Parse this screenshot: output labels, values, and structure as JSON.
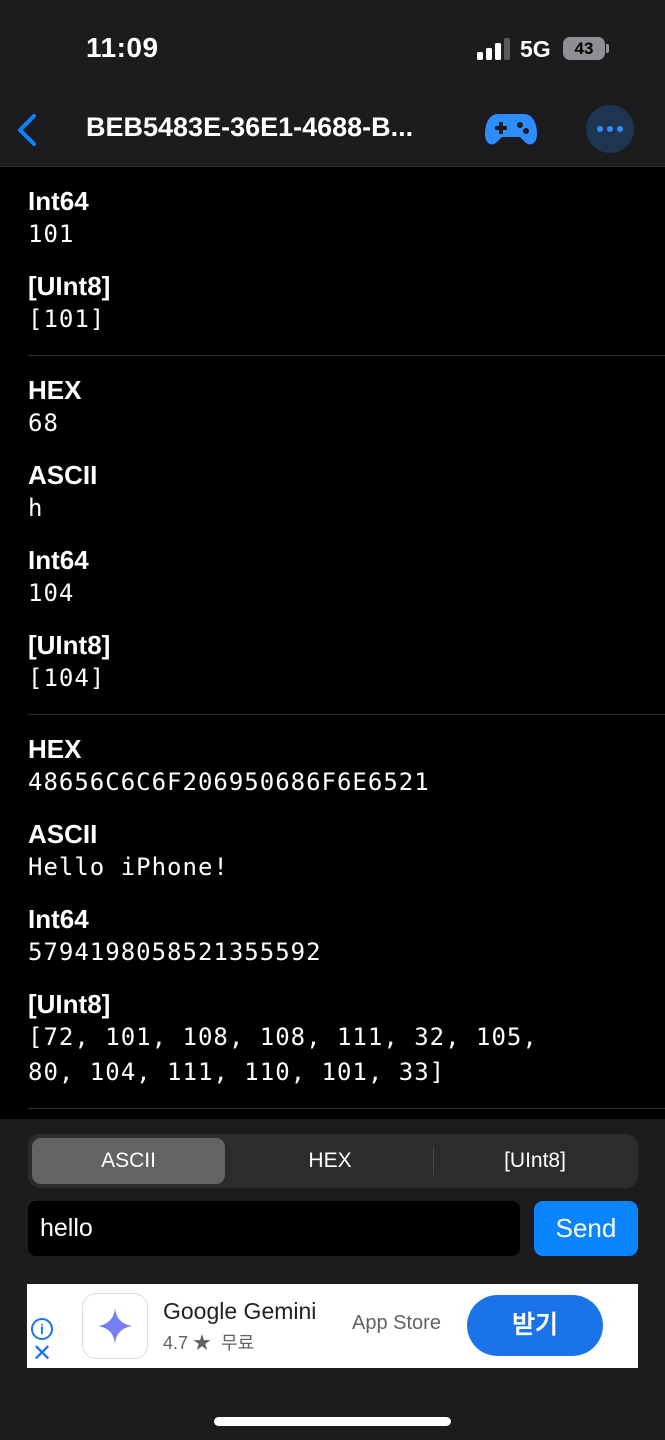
{
  "status_bar": {
    "time": "11:09",
    "network": "5G",
    "battery": "43"
  },
  "nav": {
    "title": "BEB5483E-36E1-4688-B..."
  },
  "groups": [
    {
      "fields": [
        {
          "label": "Int64",
          "value": "101"
        },
        {
          "label": "[UInt8]",
          "value": "[101]"
        }
      ]
    },
    {
      "fields": [
        {
          "label": "HEX",
          "value": "68"
        },
        {
          "label": "ASCII",
          "value": "h"
        },
        {
          "label": "Int64",
          "value": "104"
        },
        {
          "label": "[UInt8]",
          "value": "[104]"
        }
      ]
    },
    {
      "fields": [
        {
          "label": "HEX",
          "value": "48656C6C6F206950686F6E6521"
        },
        {
          "label": "ASCII",
          "value": "Hello iPhone!"
        },
        {
          "label": "Int64",
          "value": "5794198058521355592"
        },
        {
          "label": "[UInt8]",
          "value": "[72, 101, 108, 108, 111, 32, 105,\n80, 104, 111, 110, 101, 33]"
        }
      ]
    }
  ],
  "format_selector": {
    "options": [
      "ASCII",
      "HEX",
      "[UInt8]"
    ],
    "selected": "ASCII"
  },
  "composer": {
    "input_value": "hello",
    "send_label": "Send"
  },
  "ad": {
    "app_name": "Google Gemini",
    "rating": "4.7 ★",
    "price": "무료",
    "store": "App Store",
    "cta": "받기",
    "info_glyph": "i",
    "close_glyph": "✕"
  },
  "colors": {
    "accent": "#0a84ff",
    "background": "#000000",
    "bar": "#1c1c1e"
  }
}
